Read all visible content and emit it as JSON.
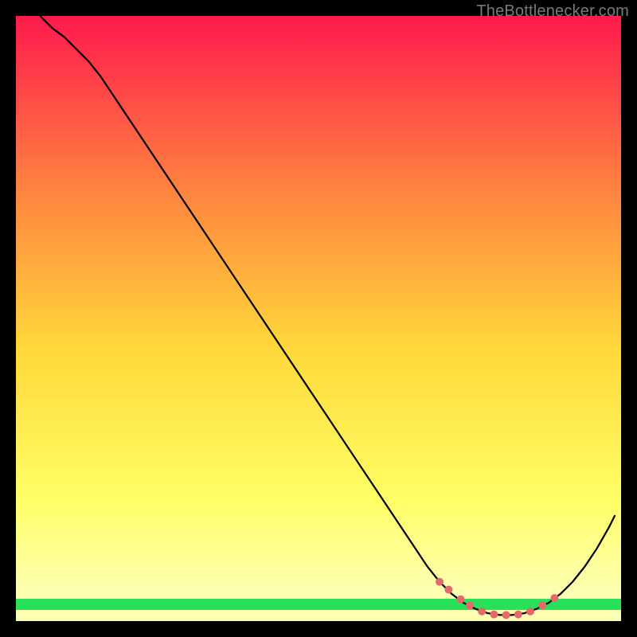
{
  "attribution": "TheBottlenecker.com",
  "chart_data": {
    "type": "line",
    "title": "",
    "xlabel": "",
    "ylabel": "",
    "xlim": [
      0,
      100
    ],
    "ylim": [
      0,
      100
    ],
    "grid": false,
    "legend": false,
    "background_gradient": {
      "top": "#ff1a4d",
      "mid_upper": "#ff8040",
      "mid": "#ffd83a",
      "lower": "#ffff66",
      "bottom_band": "#29e05a"
    },
    "series": [
      {
        "name": "bottleneck-curve",
        "color": "#000000",
        "x": [
          4,
          6,
          8,
          10,
          12,
          14,
          16,
          18,
          20,
          24,
          28,
          32,
          36,
          40,
          44,
          48,
          52,
          56,
          60,
          64,
          68,
          70,
          72,
          74,
          76,
          78,
          80,
          82,
          84,
          86,
          88,
          90,
          92,
          94,
          96,
          98,
          99
        ],
        "values": [
          100,
          98,
          96.5,
          94.5,
          92.5,
          90,
          87,
          84,
          81,
          75,
          69,
          63,
          57,
          51,
          45,
          39,
          33,
          27,
          21,
          15,
          9,
          6.5,
          4.5,
          3,
          2,
          1.3,
          1,
          1,
          1.3,
          2,
          3,
          4.5,
          6.5,
          9,
          12,
          15.5,
          17.5
        ]
      }
    ],
    "marker_points": {
      "name": "optimal-range-markers",
      "color": "#e26a6a",
      "x": [
        70,
        71.5,
        73.5,
        75,
        77,
        79,
        81,
        83,
        85,
        87,
        89
      ],
      "values": [
        6.5,
        5.2,
        3.6,
        2.6,
        1.6,
        1.1,
        1,
        1.1,
        1.6,
        2.6,
        3.8
      ]
    }
  }
}
